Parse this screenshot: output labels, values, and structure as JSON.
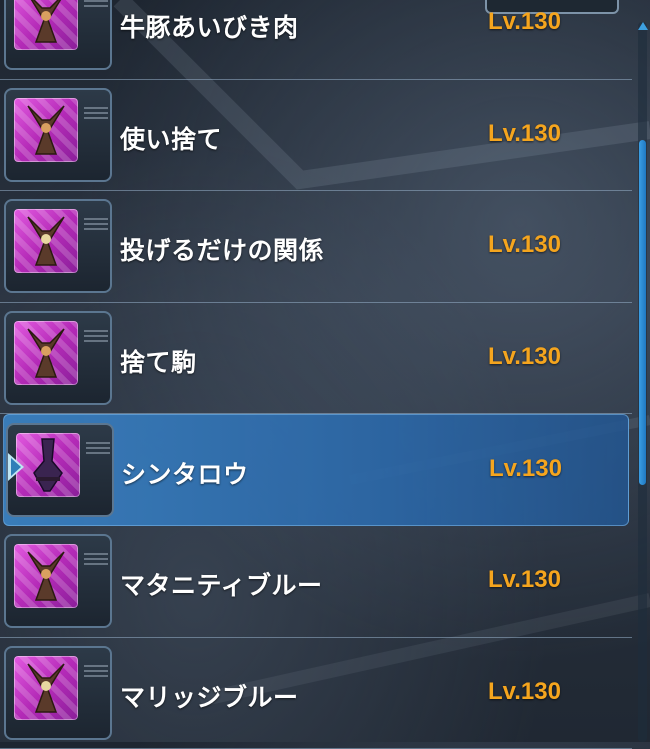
{
  "list": {
    "rows": [
      {
        "name": "牛豚あいびき肉",
        "level": "Lv.130",
        "selected": false,
        "icon": "mag-icon"
      },
      {
        "name": "使い捨て",
        "level": "Lv.130",
        "selected": false,
        "icon": "mag-icon"
      },
      {
        "name": "投げるだけの関係",
        "level": "Lv.130",
        "selected": false,
        "icon": "mag-icon"
      },
      {
        "name": "捨て駒",
        "level": "Lv.130",
        "selected": false,
        "icon": "mag-icon"
      },
      {
        "name": "シンタロウ",
        "level": "Lv.130",
        "selected": true,
        "icon": "mag-icon"
      },
      {
        "name": "マタニティブルー",
        "level": "Lv.130",
        "selected": false,
        "icon": "mag-icon"
      },
      {
        "name": "マリッジブルー",
        "level": "Lv.130",
        "selected": false,
        "icon": "mag-icon"
      }
    ]
  },
  "colors": {
    "name_text": "#ffffff",
    "level_text": "#f5a51e",
    "selected_row": "#3a80c0",
    "icon_bg": "#c43fca",
    "scrollbar": "#3b9ee3"
  }
}
